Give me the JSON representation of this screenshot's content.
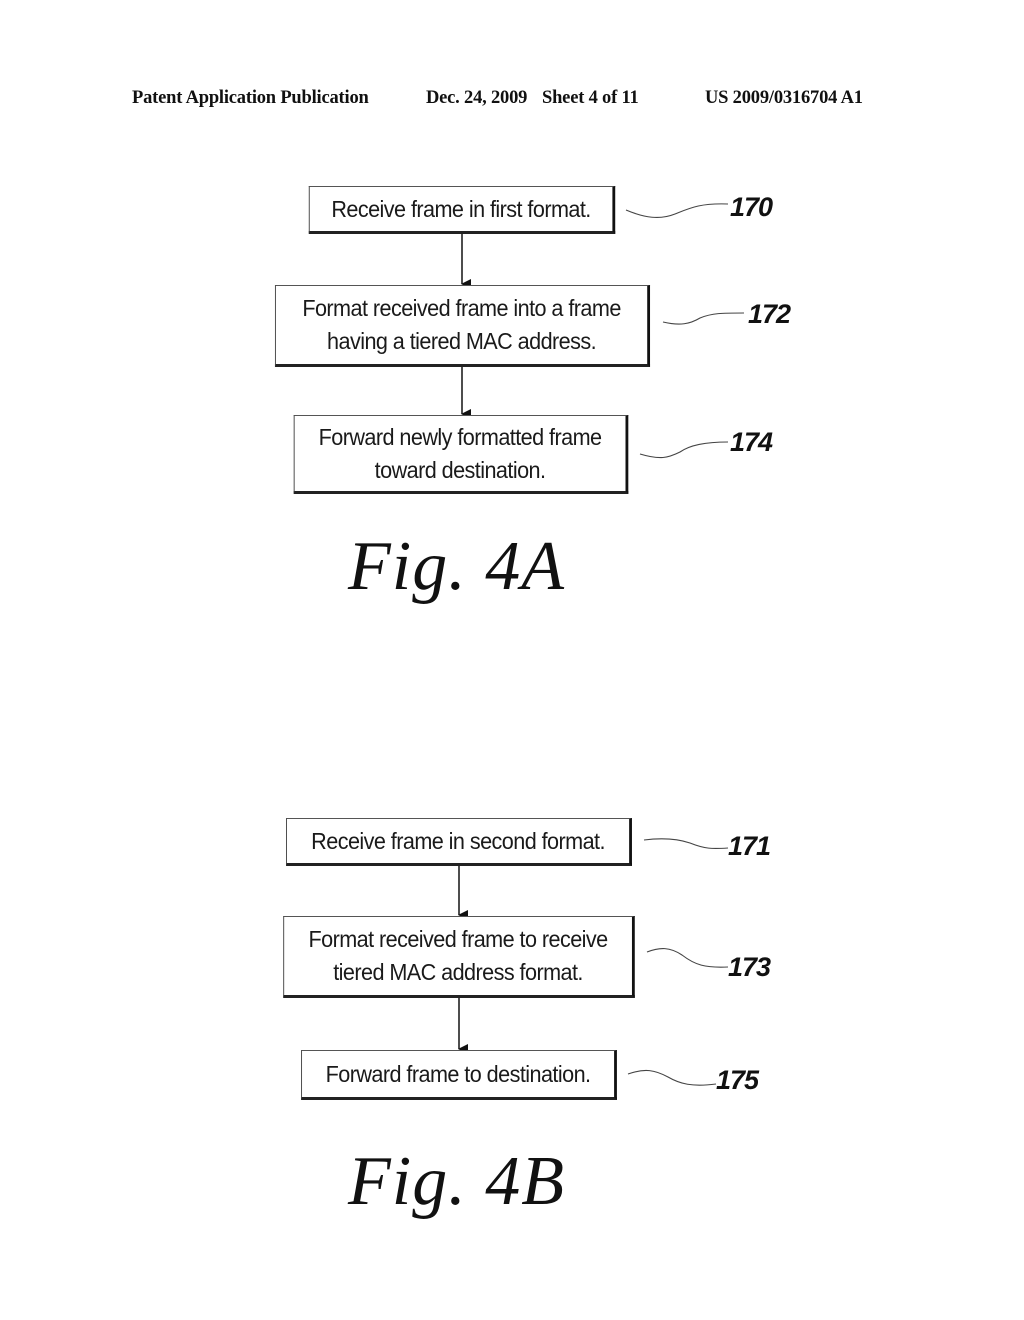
{
  "header": {
    "publication_type": "Patent Application Publication",
    "date": "Dec. 24, 2009",
    "sheet": "Sheet 4 of 11",
    "patent_number": "US 2009/0316704 A1"
  },
  "figures": [
    {
      "label": "Fig. 4A",
      "steps": [
        {
          "ref": "170",
          "lines": [
            "Receive frame in first format."
          ]
        },
        {
          "ref": "172",
          "lines": [
            "Format received frame into a frame",
            "having a tiered MAC address."
          ]
        },
        {
          "ref": "174",
          "lines": [
            "Forward newly formatted frame",
            "toward destination."
          ]
        }
      ]
    },
    {
      "label": "Fig. 4B",
      "steps": [
        {
          "ref": "171",
          "lines": [
            "Receive frame in second format."
          ]
        },
        {
          "ref": "173",
          "lines": [
            "Format received frame to receive",
            "tiered MAC address format."
          ]
        },
        {
          "ref": "175",
          "lines": [
            "Forward frame to destination."
          ]
        }
      ]
    }
  ]
}
